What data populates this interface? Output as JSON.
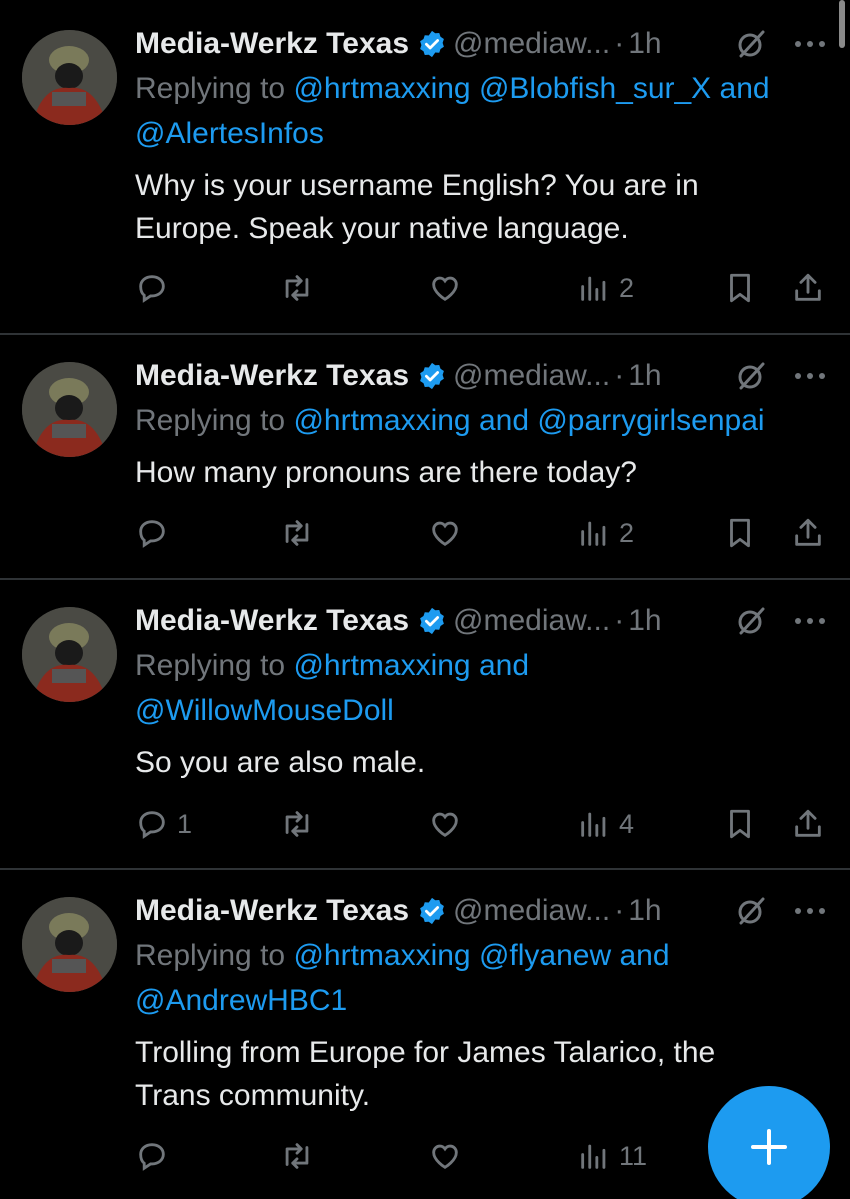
{
  "tweets": [
    {
      "author_name": "Media-Werkz Texas",
      "handle": "@mediaw...",
      "time": "1h",
      "replying_prefix": "Replying to",
      "replying_line1": "@hrtmaxxing @Blobfish_sur_X and",
      "replying_line2": "@AlertesInfos",
      "text_line1": "Why is your username English? You are in",
      "text_line2": "Europe. Speak your native language.",
      "reply_count": "",
      "views": "2"
    },
    {
      "author_name": "Media-Werkz Texas",
      "handle": "@mediaw...",
      "time": "1h",
      "replying_prefix": "Replying to",
      "replying_line1": "@hrtmaxxing and @parrygirlsenpai",
      "replying_line2": "",
      "text_line1": "How many pronouns are there today?",
      "text_line2": "",
      "reply_count": "",
      "views": "2"
    },
    {
      "author_name": "Media-Werkz Texas",
      "handle": "@mediaw...",
      "time": "1h",
      "replying_prefix": "Replying to",
      "replying_line1": "@hrtmaxxing and",
      "replying_line2": "@WillowMouseDoll",
      "text_line1": "So you are also male.",
      "text_line2": "",
      "reply_count": "1",
      "views": "4"
    },
    {
      "author_name": "Media-Werkz Texas",
      "handle": "@mediaw...",
      "time": "1h",
      "replying_prefix": "Replying to",
      "replying_line1": "@hrtmaxxing @flyanew and",
      "replying_line2": "@AndrewHBC1",
      "text_line1": "Trolling from Europe for James Talarico, the",
      "text_line2": "Trans community.",
      "reply_count": "",
      "views": "11"
    }
  ],
  "separator": "·",
  "icons": {
    "verified": "verified-badge-icon",
    "grok": "grok-icon",
    "more": "more-icon",
    "reply": "reply-icon",
    "retweet": "retweet-icon",
    "like": "heart-icon",
    "views": "views-chart-icon",
    "bookmark": "bookmark-icon",
    "share": "share-icon",
    "compose": "plus-icon"
  },
  "colors": {
    "background": "#000000",
    "accent": "#1d9bf0",
    "muted": "#71767b",
    "text": "#e7e9ea",
    "divider": "#2f3336"
  }
}
